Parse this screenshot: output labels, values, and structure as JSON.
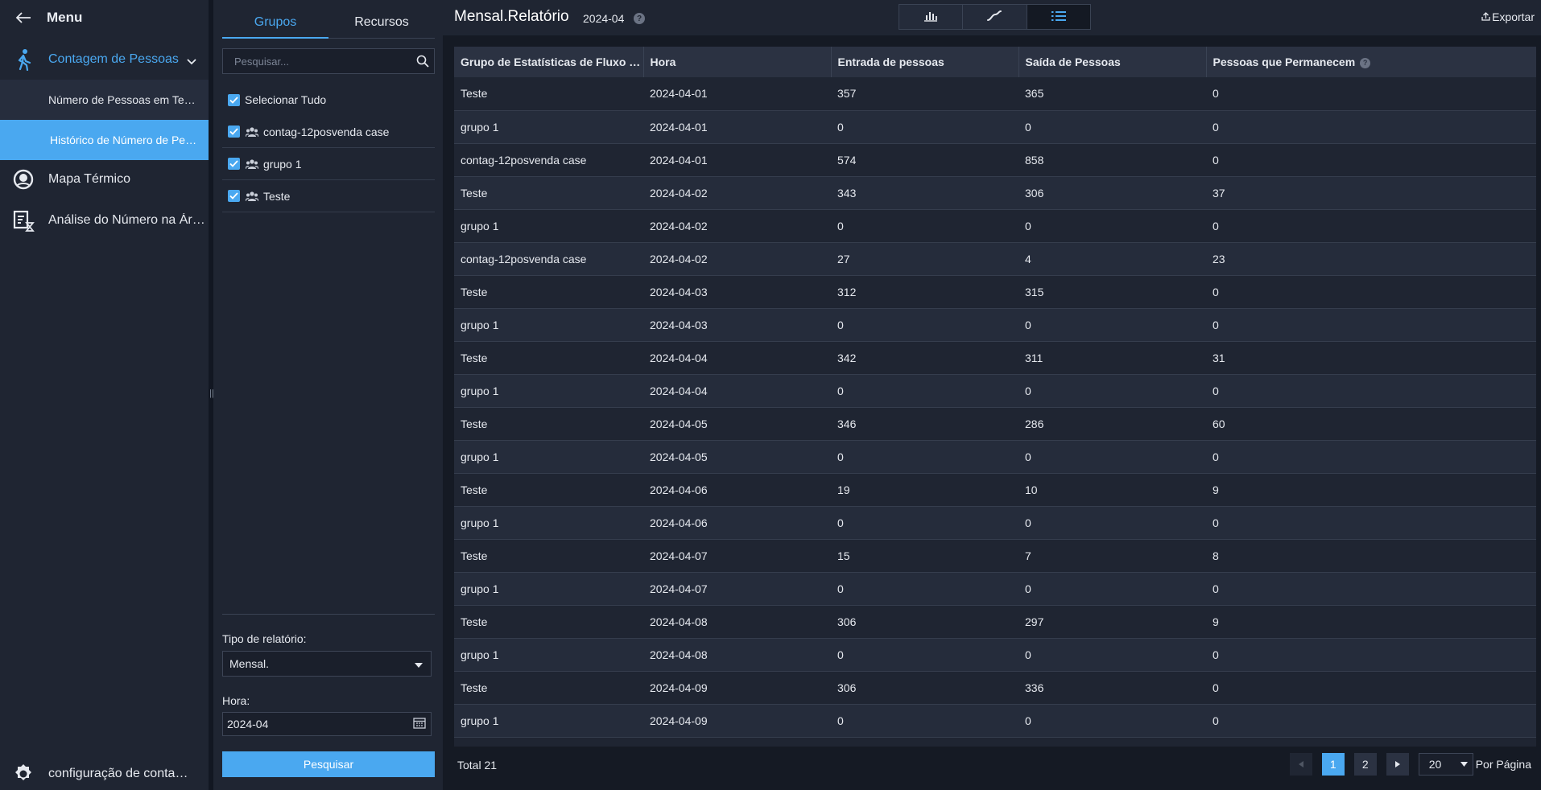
{
  "sidebar": {
    "title": "Menu",
    "items": [
      {
        "label": "Contagem de Pessoas",
        "icon": "person-walking-icon"
      },
      {
        "label": "Mapa Térmico",
        "icon": "heatmap-icon"
      },
      {
        "label": "Análise do Número na Área",
        "icon": "area-analysis-icon"
      }
    ],
    "subitems": [
      {
        "label": "Número de Pessoas em Tempo Real"
      },
      {
        "label": "Histórico de Número de Pessoas"
      }
    ],
    "footer_label": "configuração de contagem"
  },
  "panel": {
    "tabs": [
      "Grupos",
      "Recursos"
    ],
    "search_placeholder": "Pesquisar...",
    "select_all": "Selecionar Tudo",
    "groups": [
      "contag-12posvenda case",
      "grupo 1",
      "Teste"
    ],
    "report_type_label": "Tipo de relatório:",
    "report_type_value": "Mensal.",
    "time_label": "Hora:",
    "time_value": "2024-04",
    "search_button": "Pesquisar"
  },
  "header": {
    "title": "Mensal.Relatório",
    "date": "2024-04",
    "export": "Exportar"
  },
  "table": {
    "columns": [
      "Grupo de Estatísticas de Fluxo de Pessoas",
      "Hora",
      "Entrada de pessoas",
      "Saída de Pessoas",
      "Pessoas que Permanecem"
    ],
    "rows": [
      [
        "Teste",
        "2024-04-01",
        "357",
        "365",
        "0"
      ],
      [
        "grupo 1",
        "2024-04-01",
        "0",
        "0",
        "0"
      ],
      [
        "contag-12posvenda case",
        "2024-04-01",
        "574",
        "858",
        "0"
      ],
      [
        "Teste",
        "2024-04-02",
        "343",
        "306",
        "37"
      ],
      [
        "grupo 1",
        "2024-04-02",
        "0",
        "0",
        "0"
      ],
      [
        "contag-12posvenda case",
        "2024-04-02",
        "27",
        "4",
        "23"
      ],
      [
        "Teste",
        "2024-04-03",
        "312",
        "315",
        "0"
      ],
      [
        "grupo 1",
        "2024-04-03",
        "0",
        "0",
        "0"
      ],
      [
        "Teste",
        "2024-04-04",
        "342",
        "311",
        "31"
      ],
      [
        "grupo 1",
        "2024-04-04",
        "0",
        "0",
        "0"
      ],
      [
        "Teste",
        "2024-04-05",
        "346",
        "286",
        "60"
      ],
      [
        "grupo 1",
        "2024-04-05",
        "0",
        "0",
        "0"
      ],
      [
        "Teste",
        "2024-04-06",
        "19",
        "10",
        "9"
      ],
      [
        "grupo 1",
        "2024-04-06",
        "0",
        "0",
        "0"
      ],
      [
        "Teste",
        "2024-04-07",
        "15",
        "7",
        "8"
      ],
      [
        "grupo 1",
        "2024-04-07",
        "0",
        "0",
        "0"
      ],
      [
        "Teste",
        "2024-04-08",
        "306",
        "297",
        "9"
      ],
      [
        "grupo 1",
        "2024-04-08",
        "0",
        "0",
        "0"
      ],
      [
        "Teste",
        "2024-04-09",
        "306",
        "336",
        "0"
      ],
      [
        "grupo 1",
        "2024-04-09",
        "0",
        "0",
        "0"
      ]
    ]
  },
  "footer": {
    "total": "Total 21",
    "pages": [
      "1",
      "2"
    ],
    "per_page_value": "20",
    "per_page_label": "Por Página"
  },
  "colors": {
    "accent": "#4aa8f0",
    "sidebar_bg": "#1f2532",
    "main_bg": "#151a24"
  }
}
